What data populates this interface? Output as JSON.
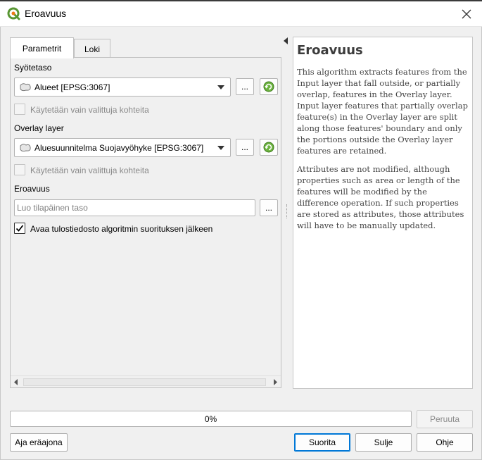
{
  "window": {
    "title": "Eroavuus",
    "close_icon": "close-icon"
  },
  "tabs": [
    {
      "label": "Parametrit",
      "active": true
    },
    {
      "label": "Loki",
      "active": false
    }
  ],
  "params": {
    "input_label": "Syötetaso",
    "input_value": "Alueet [EPSG:3067]",
    "input_selected_only": "Käytetään vain valittuja kohteita",
    "overlay_label": "Overlay layer",
    "overlay_value": "Aluesuunnitelma Suojavyöhyke [EPSG:3067]",
    "overlay_selected_only": "Käytetään vain valittuja kohteita",
    "output_label": "Eroavuus",
    "output_placeholder": "Luo tilapäinen taso",
    "browse_label": "...",
    "open_output": "Avaa tulostiedosto algoritmin suorituksen jälkeen",
    "open_output_checked": true
  },
  "help": {
    "title": "Eroavuus",
    "p1": "This algorithm extracts features from the Input layer that fall outside, or partially overlap, features in the Overlay layer. Input layer features that partially overlap feature(s) in the Overlay layer are split along those features' boundary and only the portions outside the Overlay layer features are retained.",
    "p2": "Attributes are not modified, although properties such as area or length of the features will be modified by the difference operation. If such properties are stored as attributes, those attributes will have to be manually updated."
  },
  "progress": {
    "text": "0%",
    "value": 0
  },
  "buttons": {
    "cancel": "Peruuta",
    "batch": "Aja eräajona",
    "run": "Suorita",
    "close": "Sulje",
    "help": "Ohje"
  },
  "colors": {
    "accent": "#0078d7",
    "qgis_green": "#589632",
    "qgis_yellow": "#ee7913"
  }
}
